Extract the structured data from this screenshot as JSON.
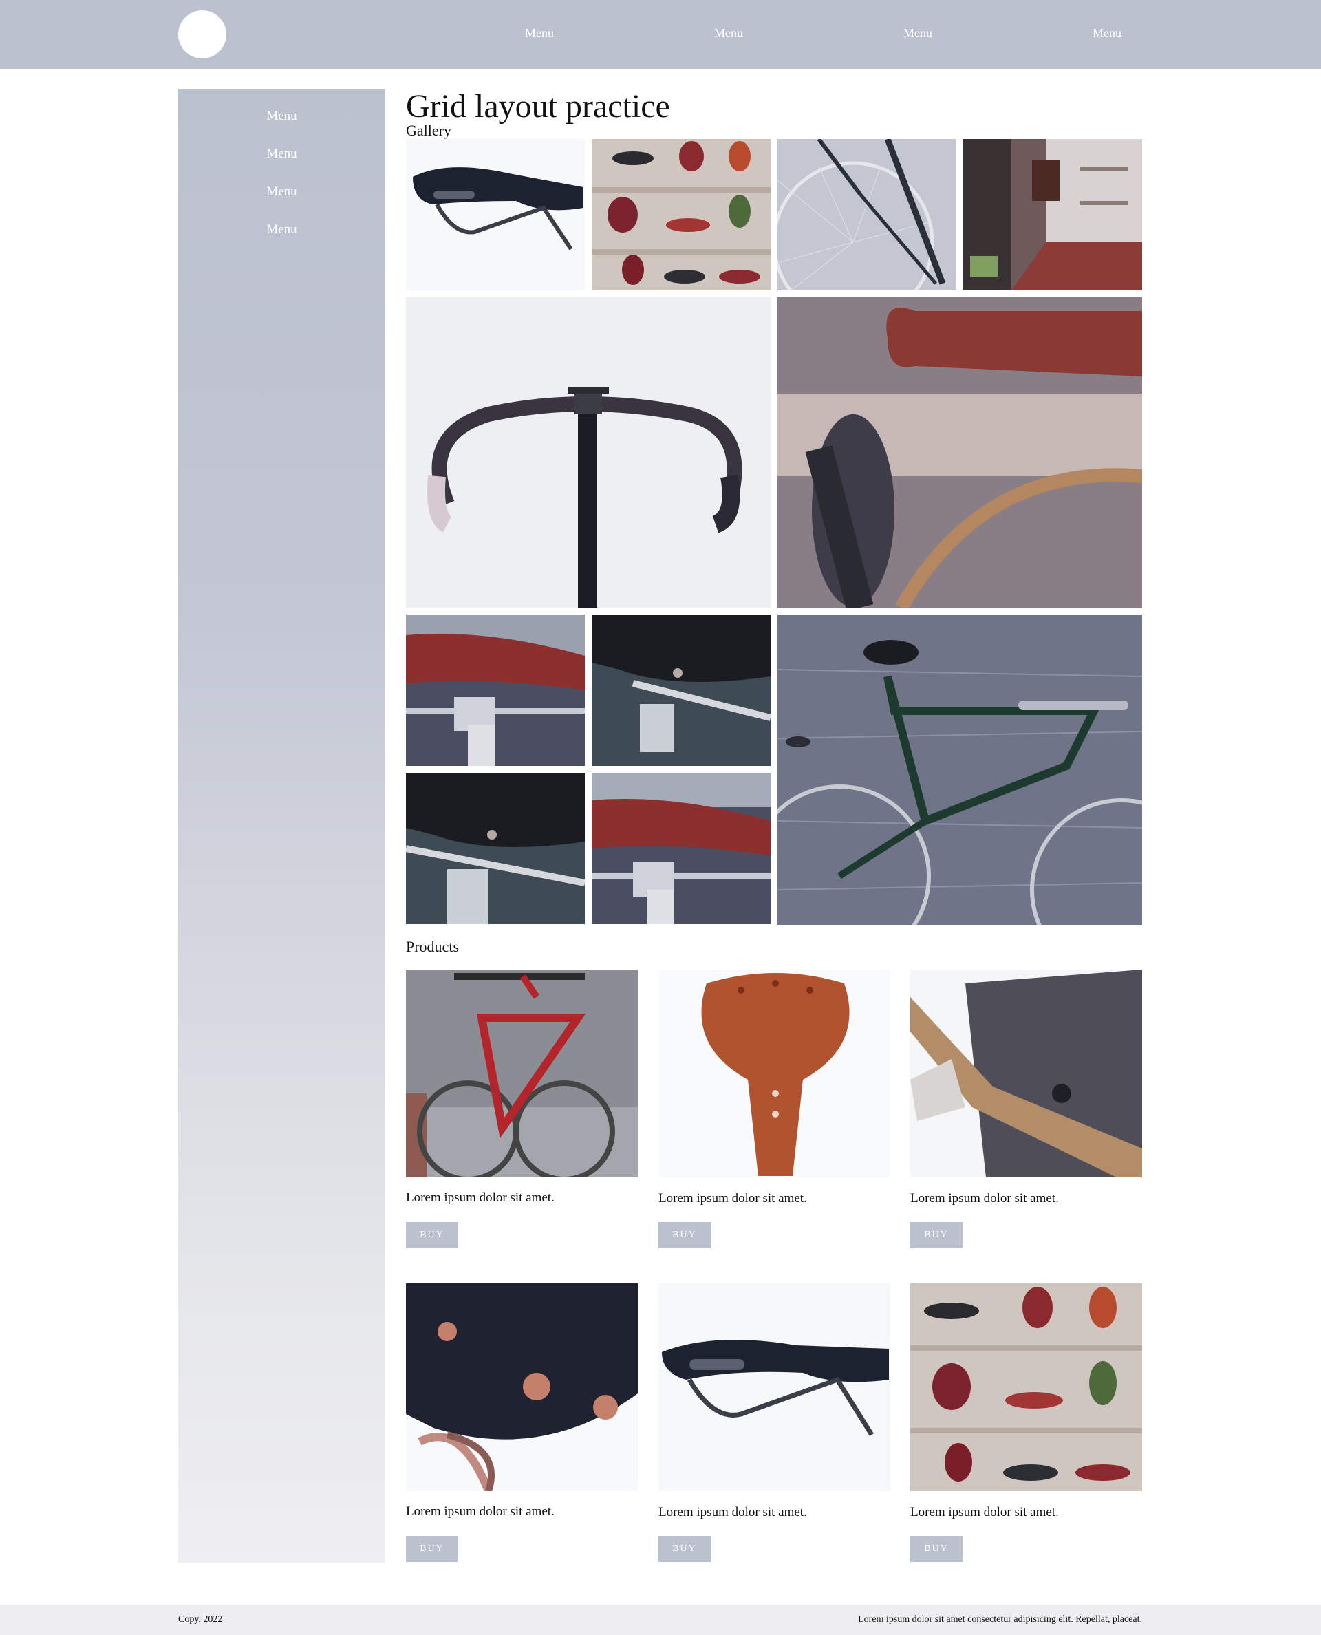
{
  "header": {
    "nav": [
      "Menu",
      "Menu",
      "Menu",
      "Menu"
    ]
  },
  "sidebar": {
    "items": [
      "Menu",
      "Menu",
      "Menu",
      "Menu"
    ]
  },
  "main": {
    "title": "Grid layout practice",
    "gallery_title": "Gallery",
    "products_title": "Products"
  },
  "products": [
    {
      "caption": "Lorem ipsum dolor sit amet.",
      "button": "BUY"
    },
    {
      "caption": "Lorem ipsum dolor sit amet.",
      "button": "BUY"
    },
    {
      "caption": "Lorem ipsum dolor sit amet.",
      "button": "BUY"
    },
    {
      "caption": "Lorem ipsum dolor sit amet.",
      "button": "BUY"
    },
    {
      "caption": "Lorem ipsum dolor sit amet.",
      "button": "BUY"
    },
    {
      "caption": "Lorem ipsum dolor sit amet.",
      "button": "BUY"
    }
  ],
  "footer": {
    "copy": "Copy, 2022",
    "text": "Lorem ipsum dolor sit amet consectetur adipisicing elit. Repellat, placeat."
  },
  "colors": {
    "accent": "#bcc1d0",
    "footer_bg": "#eeeef0"
  }
}
